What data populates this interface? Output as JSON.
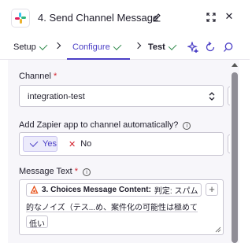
{
  "header": {
    "title": "4. Send Channel Message",
    "app_icon": "slack-icon",
    "edit_icon": "pencil-icon",
    "expand_icon": "expand-icon",
    "close_icon": "close-icon",
    "close_glyph": "✕"
  },
  "tabs": [
    {
      "label": "Setup",
      "status": "complete"
    },
    {
      "label": "Configure",
      "status": "complete",
      "active": true
    },
    {
      "label": "Test",
      "status": "complete"
    }
  ],
  "tab_tools": [
    "sparkle-icon",
    "refresh-icon",
    "search-icon"
  ],
  "form": {
    "channel": {
      "label": "Channel",
      "required_mark": "*",
      "value": "integration-test"
    },
    "add_app": {
      "label": "Add Zapier app to channel automatically?",
      "info_glyph": "i",
      "options": [
        {
          "label": "Yes",
          "selected": true,
          "icon": "check-icon"
        },
        {
          "label": "No",
          "selected": false,
          "icon": "x-icon"
        }
      ],
      "x_glyph": "✕"
    },
    "message_text": {
      "label": "Message Text",
      "required_mark": "*",
      "info_glyph": "i",
      "pill_label": "3. Choices Message Content:",
      "pill_value_line1": "判定: スパム",
      "pill_value_line2": "的なノイズ（テス...め、案件化の可能性は極めて",
      "pill_value_line3": "低い",
      "plus_glyph": "+"
    }
  },
  "colors": {
    "accent": "#4b3fc6",
    "success": "#2e8a4b",
    "required": "#d4232e",
    "panel_bg": "#f7f6fa"
  }
}
